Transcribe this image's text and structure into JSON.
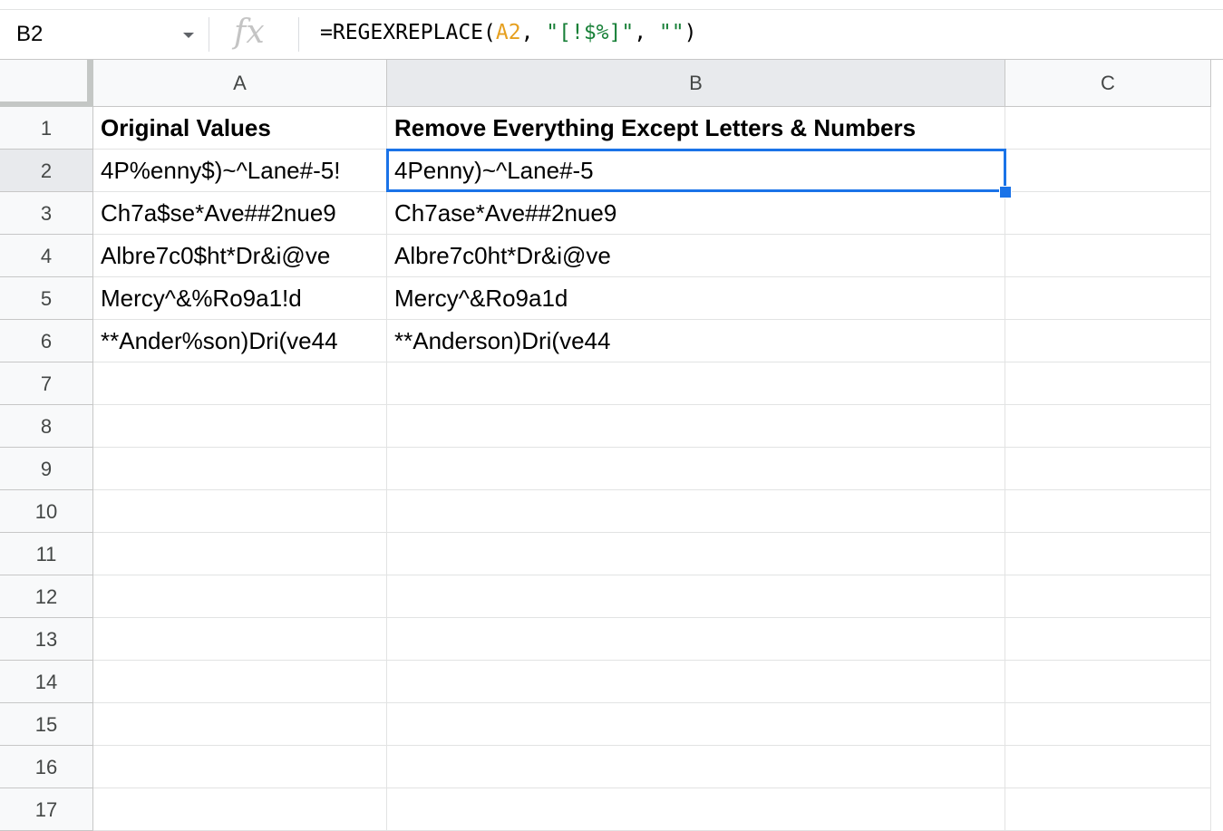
{
  "formula_bar": {
    "name_box": "B2",
    "fx_label": "fx",
    "formula": {
      "prefix": "=REGEXREPLACE(",
      "ref": "A2",
      "sep1": ", ",
      "pattern": "\"[!$%]\"",
      "sep2": ", ",
      "replacement": "\"\"",
      "suffix": ")"
    }
  },
  "columns": [
    "A",
    "B",
    "C"
  ],
  "rows": [
    "1",
    "2",
    "3",
    "4",
    "5",
    "6",
    "7",
    "8",
    "9",
    "10",
    "11",
    "12",
    "13",
    "14",
    "15",
    "16",
    "17"
  ],
  "cells": {
    "A": [
      "Original Values",
      "4P%enny$)~^Lane#-5!",
      "Ch7a$se*Ave##2nue9",
      "Albre7c0$ht*Dr&i@ve",
      "Mercy^&%Ro9a1!d",
      "**Ander%son)Dri(ve44"
    ],
    "B": [
      "Remove Everything Except Letters & Numbers",
      "4Penny)~^Lane#-5",
      "Ch7ase*Ave##2nue9",
      "Albre7c0ht*Dr&i@ve",
      "Mercy^&Ro9a1d",
      "**Anderson)Dri(ve44"
    ]
  },
  "selection": {
    "cell": "B2"
  },
  "colors": {
    "selection": "#1a73e8",
    "formula_ref": "#e6a020",
    "formula_string": "#188038"
  }
}
